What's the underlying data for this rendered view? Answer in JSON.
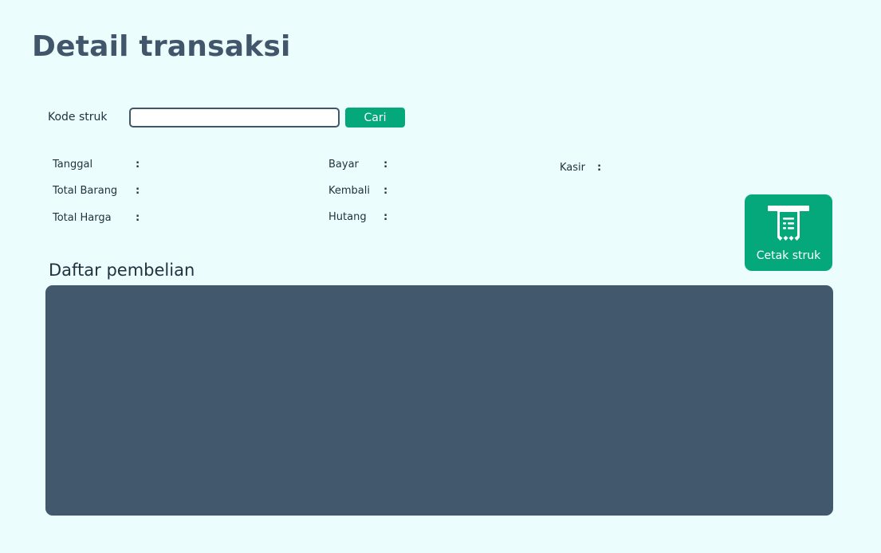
{
  "page": {
    "title": "Detail transaksi"
  },
  "search": {
    "label": "Kode struk",
    "value": "",
    "placeholder": "",
    "button_label": "Cari"
  },
  "info": {
    "tanggal": {
      "label": "Tanggal",
      "separator": ":",
      "value": ""
    },
    "total_barang": {
      "label": "Total Barang",
      "separator": ":",
      "value": ""
    },
    "total_harga": {
      "label": "Total Harga",
      "separator": ":",
      "value": ""
    },
    "bayar": {
      "label": "Bayar",
      "separator": ":",
      "value": ""
    },
    "kembali": {
      "label": "Kembali",
      "separator": ":",
      "value": ""
    },
    "hutang": {
      "label": "Hutang",
      "separator": ":",
      "value": ""
    },
    "kasir": {
      "label": "Kasir",
      "separator": ":",
      "value": ""
    }
  },
  "print_button": {
    "label": "Cetak struk",
    "icon": "receipt-printer-icon"
  },
  "purchases": {
    "title": "Daftar pembelian",
    "rows": []
  },
  "colors": {
    "background": "#ebfdfd",
    "accent": "#05a87b",
    "title": "#42566b",
    "table_background": "#42586d"
  }
}
